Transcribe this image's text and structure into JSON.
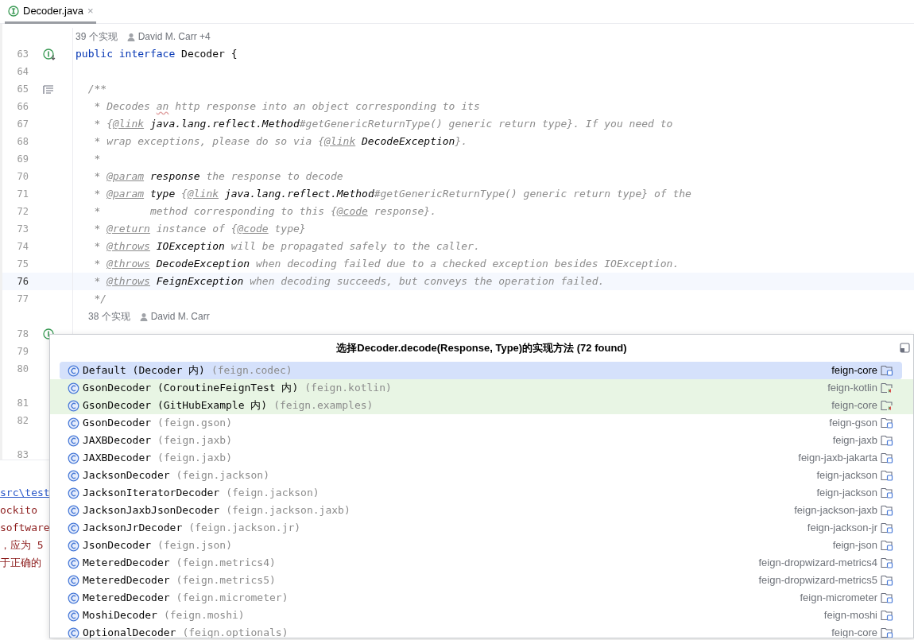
{
  "tabs": [
    {
      "title": "Decoder.java",
      "close_label": "×",
      "selected": true
    }
  ],
  "editor": {
    "lines": [
      {
        "kind": "hint",
        "count": "39 个实现",
        "author": "David M. Carr +4",
        "indented": false
      },
      {
        "kind": "code",
        "number": "63",
        "gutter": {
          "kind": "interface"
        },
        "current": false,
        "segments": [
          {
            "kind": "keyword",
            "text": "public interface"
          },
          {
            "kind": "plain",
            "text": " Decoder {"
          }
        ]
      },
      {
        "kind": "code",
        "number": "64",
        "current": false
      },
      {
        "kind": "code",
        "number": "65",
        "gutter": {
          "kind": "doc"
        },
        "current": false,
        "segments": [
          {
            "kind": "doc",
            "text": "  /**"
          }
        ]
      },
      {
        "kind": "code",
        "number": "66",
        "current": false,
        "segments": [
          {
            "kind": "doc",
            "text": "   * Decodes "
          },
          {
            "kind": "typo",
            "text": "an"
          },
          {
            "kind": "doc",
            "text": " http response into an object corresponding to its"
          }
        ]
      },
      {
        "kind": "code",
        "number": "67",
        "current": false,
        "segments": [
          {
            "kind": "doc",
            "text": "   * {"
          },
          {
            "kind": "tag",
            "text": "@link"
          },
          {
            "kind": "ref",
            "text": " java.lang.reflect.Method"
          },
          {
            "kind": "doc",
            "text": "#getGenericReturnType() generic return type}. If you need to"
          }
        ]
      },
      {
        "kind": "code",
        "number": "68",
        "current": false,
        "segments": [
          {
            "kind": "doc",
            "text": "   * wrap exceptions, please do so via {"
          },
          {
            "kind": "tag",
            "text": "@link"
          },
          {
            "kind": "ref",
            "text": " DecodeException"
          },
          {
            "kind": "doc",
            "text": "}."
          }
        ]
      },
      {
        "kind": "code",
        "number": "69",
        "current": false,
        "segments": [
          {
            "kind": "doc",
            "text": "   *"
          }
        ]
      },
      {
        "kind": "code",
        "number": "70",
        "current": false,
        "segments": [
          {
            "kind": "doc",
            "text": "   * "
          },
          {
            "kind": "tag",
            "text": "@param"
          },
          {
            "kind": "ref",
            "text": " response"
          },
          {
            "kind": "doc",
            "text": " the response to decode"
          }
        ]
      },
      {
        "kind": "code",
        "number": "71",
        "current": false,
        "segments": [
          {
            "kind": "doc",
            "text": "   * "
          },
          {
            "kind": "tag",
            "text": "@param"
          },
          {
            "kind": "ref",
            "text": " type"
          },
          {
            "kind": "doc",
            "text": " {"
          },
          {
            "kind": "tag",
            "text": "@link"
          },
          {
            "kind": "ref",
            "text": " java.lang.reflect.Method"
          },
          {
            "kind": "doc",
            "text": "#getGenericReturnType() generic return type} of the"
          }
        ]
      },
      {
        "kind": "code",
        "number": "72",
        "current": false,
        "segments": [
          {
            "kind": "doc",
            "text": "   *        method corresponding to this {"
          },
          {
            "kind": "tag",
            "text": "@code"
          },
          {
            "kind": "doc",
            "text": " response}."
          }
        ]
      },
      {
        "kind": "code",
        "number": "73",
        "current": false,
        "segments": [
          {
            "kind": "doc",
            "text": "   * "
          },
          {
            "kind": "tag",
            "text": "@return"
          },
          {
            "kind": "doc",
            "text": " instance of {"
          },
          {
            "kind": "tag",
            "text": "@code"
          },
          {
            "kind": "doc",
            "text": " type}"
          }
        ]
      },
      {
        "kind": "code",
        "number": "74",
        "current": false,
        "segments": [
          {
            "kind": "doc",
            "text": "   * "
          },
          {
            "kind": "tag",
            "text": "@throws"
          },
          {
            "kind": "ref",
            "text": " IOException"
          },
          {
            "kind": "doc",
            "text": " will be propagated safely to the caller."
          }
        ]
      },
      {
        "kind": "code",
        "number": "75",
        "current": false,
        "segments": [
          {
            "kind": "doc",
            "text": "   * "
          },
          {
            "kind": "tag",
            "text": "@throws"
          },
          {
            "kind": "ref",
            "text": " DecodeException"
          },
          {
            "kind": "doc",
            "text": " when decoding failed due to a checked exception besides IOException."
          }
        ]
      },
      {
        "kind": "code",
        "number": "76",
        "current": true,
        "segments": [
          {
            "kind": "doc",
            "text": "   * "
          },
          {
            "kind": "tag",
            "text": "@throws"
          },
          {
            "kind": "ref",
            "text": " FeignException"
          },
          {
            "kind": "doc",
            "text": " when decoding succeeds, but conveys the operation failed."
          }
        ]
      },
      {
        "kind": "code",
        "number": "77",
        "current": false,
        "segments": [
          {
            "kind": "doc",
            "text": "   */"
          }
        ]
      },
      {
        "kind": "hint",
        "count": "38 个实现",
        "author": "David M. Carr",
        "indented": true
      },
      {
        "kind": "code",
        "number": "78",
        "gutter": {
          "kind": "method"
        },
        "current": false
      },
      {
        "kind": "code",
        "number": "79",
        "current": false
      },
      {
        "kind": "code",
        "number": "80",
        "current": false
      },
      {
        "kind": "gap"
      },
      {
        "kind": "code",
        "number": "81",
        "current": false
      },
      {
        "kind": "code",
        "number": "82",
        "current": false
      },
      {
        "kind": "gap"
      },
      {
        "kind": "code",
        "number": "83",
        "current": false
      }
    ]
  },
  "console": {
    "lines": [
      {
        "kind": "link",
        "text": "src\\test"
      },
      {
        "kind": "error",
        "text": "ockito"
      },
      {
        "kind": "error",
        "text": "software"
      },
      {
        "kind": "error",
        "text": "，应为 5"
      },
      {
        "kind": "error",
        "text": "于正确的"
      }
    ]
  },
  "popup": {
    "title": "选择Decoder.decode(Response, Type)的实现方法 (72 found)",
    "items": [
      {
        "name": "Default",
        "qualifier": "(Decoder 内)",
        "package": "(feign.codec)",
        "module": "feign-core",
        "selected": true,
        "kind": "main"
      },
      {
        "name": "GsonDecoder",
        "qualifier": "(CoroutineFeignTest 内)",
        "package": "(feign.kotlin)",
        "module": "feign-kotlin",
        "selected": false,
        "kind": "test"
      },
      {
        "name": "GsonDecoder",
        "qualifier": "(GitHubExample 内)",
        "package": "(feign.examples)",
        "module": "feign-core",
        "selected": false,
        "kind": "test"
      },
      {
        "name": "GsonDecoder",
        "package": "(feign.gson)",
        "module": "feign-gson",
        "selected": false,
        "kind": "main"
      },
      {
        "name": "JAXBDecoder",
        "package": "(feign.jaxb)",
        "module": "feign-jaxb",
        "selected": false,
        "kind": "main"
      },
      {
        "name": "JAXBDecoder",
        "package": "(feign.jaxb)",
        "module": "feign-jaxb-jakarta",
        "selected": false,
        "kind": "main"
      },
      {
        "name": "JacksonDecoder",
        "package": "(feign.jackson)",
        "module": "feign-jackson",
        "selected": false,
        "kind": "main"
      },
      {
        "name": "JacksonIteratorDecoder",
        "package": "(feign.jackson)",
        "module": "feign-jackson",
        "selected": false,
        "kind": "main"
      },
      {
        "name": "JacksonJaxbJsonDecoder",
        "package": "(feign.jackson.jaxb)",
        "module": "feign-jackson-jaxb",
        "selected": false,
        "kind": "main"
      },
      {
        "name": "JacksonJrDecoder",
        "package": "(feign.jackson.jr)",
        "module": "feign-jackson-jr",
        "selected": false,
        "kind": "main"
      },
      {
        "name": "JsonDecoder",
        "package": "(feign.json)",
        "module": "feign-json",
        "selected": false,
        "kind": "main"
      },
      {
        "name": "MeteredDecoder",
        "package": "(feign.metrics4)",
        "module": "feign-dropwizard-metrics4",
        "selected": false,
        "kind": "main"
      },
      {
        "name": "MeteredDecoder",
        "package": "(feign.metrics5)",
        "module": "feign-dropwizard-metrics5",
        "selected": false,
        "kind": "main"
      },
      {
        "name": "MeteredDecoder",
        "package": "(feign.micrometer)",
        "module": "feign-micrometer",
        "selected": false,
        "kind": "main"
      },
      {
        "name": "MoshiDecoder",
        "package": "(feign.moshi)",
        "module": "feign-moshi",
        "selected": false,
        "kind": "main"
      },
      {
        "name": "OptionalDecoder",
        "package": "(feign.optionals)",
        "module": "feign-core",
        "selected": false,
        "kind": "main"
      }
    ]
  }
}
